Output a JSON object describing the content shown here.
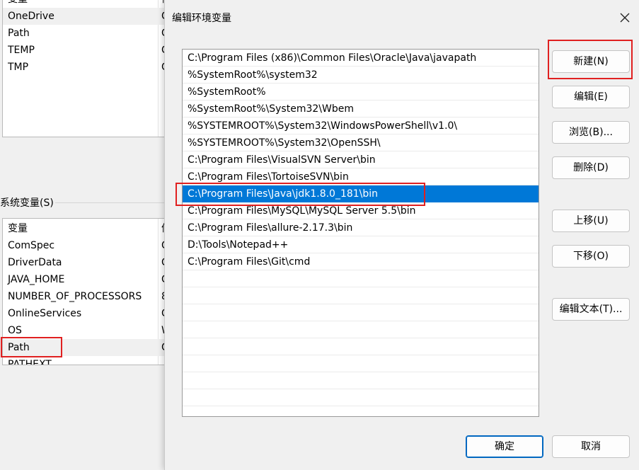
{
  "parent": {
    "user_vars": {
      "header_name": "变量",
      "header_value": "值",
      "rows": [
        {
          "name": "OneDrive",
          "value": "C"
        },
        {
          "name": "Path",
          "value": "C"
        },
        {
          "name": "TEMP",
          "value": "C"
        },
        {
          "name": "TMP",
          "value": "C"
        }
      ]
    },
    "system_vars": {
      "group_label": "系统变量(S)",
      "header_name": "变量",
      "header_value": "值",
      "rows": [
        {
          "name": "ComSpec",
          "value": "C"
        },
        {
          "name": "DriverData",
          "value": "C"
        },
        {
          "name": "JAVA_HOME",
          "value": "C"
        },
        {
          "name": "NUMBER_OF_PROCESSORS",
          "value": "8"
        },
        {
          "name": "OnlineServices",
          "value": "C"
        },
        {
          "name": "OS",
          "value": "W"
        },
        {
          "name": "Path",
          "value": "C"
        },
        {
          "name": "PATHEXT",
          "value": ""
        }
      ]
    }
  },
  "dialog": {
    "title": "编辑环境变量",
    "close_icon": "close-icon",
    "paths": [
      "C:\\Program Files (x86)\\Common Files\\Oracle\\Java\\javapath",
      "%SystemRoot%\\system32",
      "%SystemRoot%",
      "%SystemRoot%\\System32\\Wbem",
      "%SYSTEMROOT%\\System32\\WindowsPowerShell\\v1.0\\",
      "%SYSTEMROOT%\\System32\\OpenSSH\\",
      "C:\\Program Files\\VisualSVN Server\\bin",
      "C:\\Program Files\\TortoiseSVN\\bin",
      "C:\\Program Files\\Java\\jdk1.8.0_181\\bin",
      "C:\\Program Files\\MySQL\\MySQL Server 5.5\\bin",
      "C:\\Program Files\\allure-2.17.3\\bin",
      "D:\\Tools\\Notepad++",
      "C:\\Program Files\\Git\\cmd"
    ],
    "selected_index": 8,
    "buttons": {
      "new": "新建(N)",
      "edit": "编辑(E)",
      "browse": "浏览(B)...",
      "delete": "删除(D)",
      "move_up": "上移(U)",
      "move_down": "下移(O)",
      "edit_text": "编辑文本(T)...",
      "ok": "确定",
      "cancel": "取消"
    }
  },
  "colors": {
    "selection": "#0078d7",
    "annotation": "#e02020"
  }
}
